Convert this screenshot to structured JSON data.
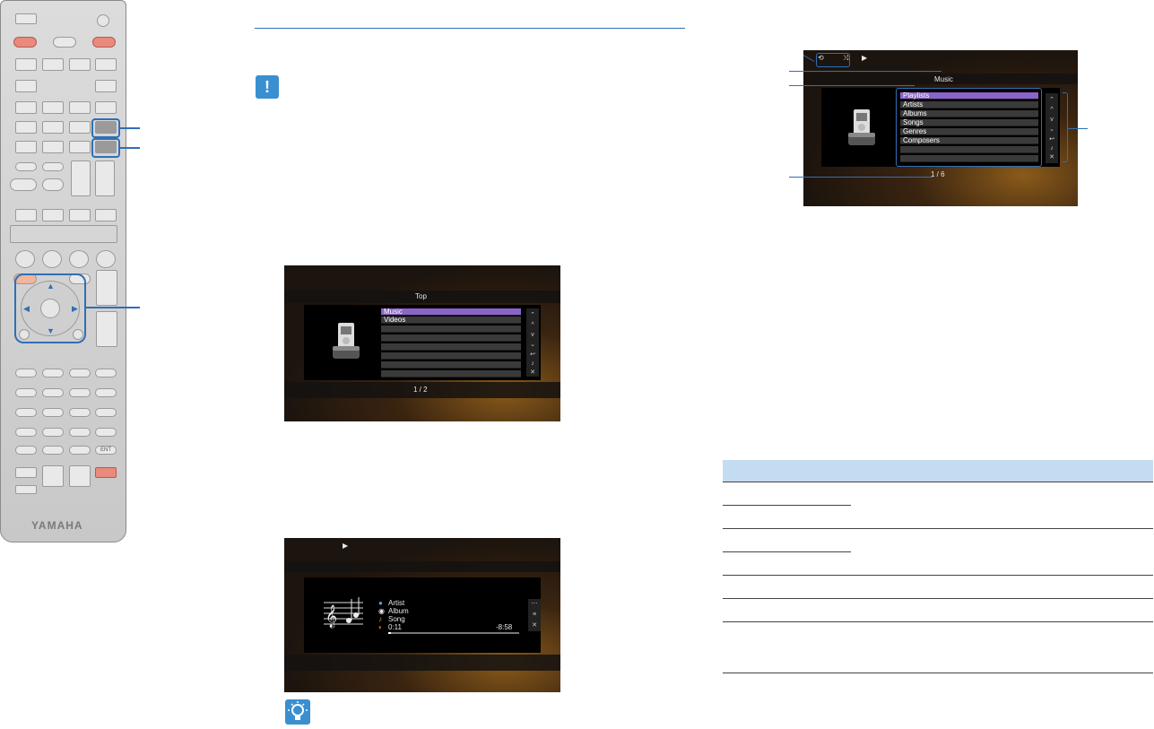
{
  "screens": {
    "top_menu": {
      "title": "Top",
      "items": [
        "Music",
        "Videos"
      ],
      "page": "1 / 2"
    },
    "music_menu": {
      "title": "Music",
      "items": [
        "Playlists",
        "Artists",
        "Albums",
        "Songs",
        "Genres",
        "Composers"
      ],
      "page": "1 / 6"
    },
    "playback": {
      "artist": "Artist",
      "album": "Album",
      "song": "Song",
      "elapsed": "0:11",
      "remaining": "-8:58",
      "progress_percent": 2
    }
  },
  "remote": {
    "brand": "YAMAHA",
    "enter_label": "ENT"
  },
  "icons": {
    "warning": "exclamation-icon",
    "tip": "lightbulb-icon"
  },
  "colors": {
    "accent": "#2f6fb5",
    "selection": "#8a64c8",
    "table_header": "#c4dcf2"
  }
}
